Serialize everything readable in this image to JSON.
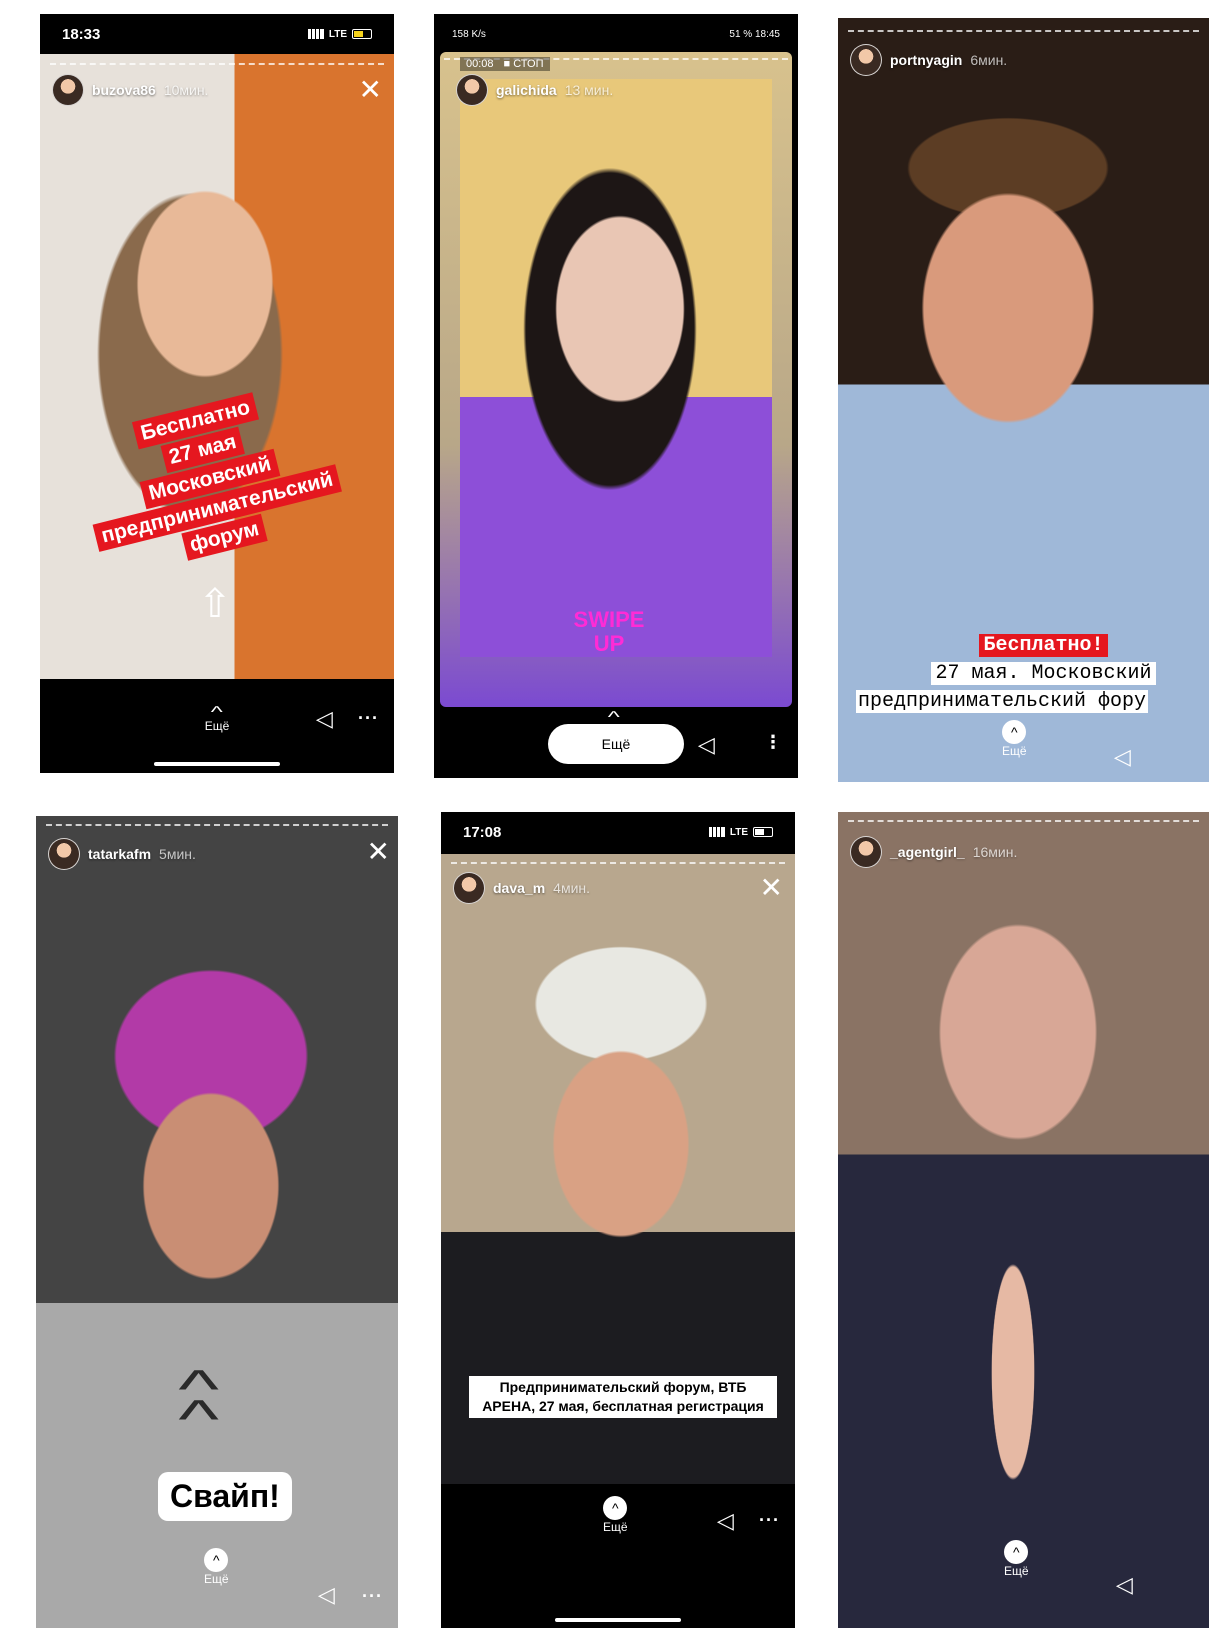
{
  "s1": {
    "time": "18:33",
    "carrier": "LTE",
    "user": "buzova86",
    "ago": "10мин.",
    "tags": [
      "Бесплатно",
      "27 мая",
      "Московский",
      "предпринимательский",
      "форум"
    ],
    "more": "Ещё"
  },
  "s2": {
    "status_right": "51 % 18:45",
    "status_left": "158 K/s",
    "rec_time": "00:08",
    "rec_stop": "■ СТОП",
    "user": "galichida",
    "ago": "13 мин.",
    "swipe_line1": "SWIPE",
    "swipe_line2": "UP",
    "more": "Ещё"
  },
  "s3": {
    "user": "portnyagin",
    "ago": "6мин.",
    "line1": "Бесплатно!",
    "line2": "27 мая. Московский",
    "line3": "предпринимательский фору",
    "more": "Ещё"
  },
  "s4": {
    "user": "tatarkafm",
    "ago": "5мин.",
    "swipe": "Свайп!",
    "more": "Ещё"
  },
  "s5": {
    "time": "17:08",
    "carrier": "LTE",
    "user": "dava_m",
    "ago": "4мин.",
    "caption": "Предпринимательский форум, ВТБ АРЕНА, 27 мая, бесплатная регистрация",
    "more": "Ещё"
  },
  "s6": {
    "user": "_agentgirl_",
    "ago": "16мин.",
    "more": "Ещё"
  },
  "colors": {
    "red": "#e5171f",
    "magenta": "#ff2bd6",
    "purple": "#7b4ad1"
  }
}
